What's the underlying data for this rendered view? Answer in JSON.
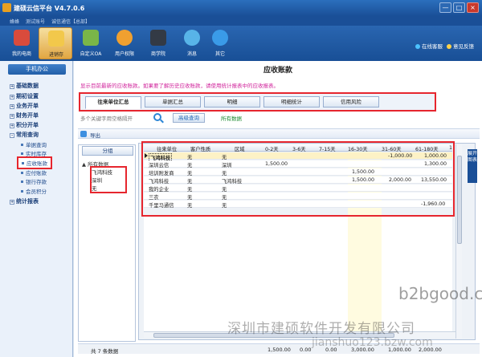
{
  "window": {
    "title": "建硕云信平台 V4.7.0.6",
    "min": "—",
    "max": "□",
    "close": "×"
  },
  "userbar": {
    "user": "蜂蜂",
    "account": "测试账号",
    "company": "诚信通信【总部】"
  },
  "topright": {
    "service": "在线客服",
    "feedback": "意见反馈"
  },
  "toolbar": [
    {
      "label": "我的电商",
      "icon": "home-icon",
      "color": "#d94b3c"
    },
    {
      "label": "进销存",
      "icon": "notepad-icon",
      "color": "#f2c84b"
    },
    {
      "label": "自定义OA",
      "icon": "pencil-ruler-icon",
      "color": "#7ab648"
    },
    {
      "label": "用户权限",
      "icon": "users-icon",
      "color": "#f0a030"
    },
    {
      "label": "商学院",
      "icon": "graduation-cap-icon",
      "color": "#333a45"
    },
    {
      "label": "消息",
      "icon": "chat-bubble-icon",
      "color": "#58b4e8"
    },
    {
      "label": "其它",
      "icon": "download-arrow-icon",
      "color": "#3a9be8"
    }
  ],
  "sidebar": {
    "head": "手机办公",
    "groups": [
      "基础数据",
      "期初设置",
      "业务开单",
      "财务开单",
      "积分开单",
      "常用查询"
    ],
    "subitems": [
      "单据查询",
      "实时库存",
      "应收账款",
      "应付账款",
      "银行存款",
      "会员积分"
    ],
    "selected": "应收账款",
    "last_group": "统计报表"
  },
  "main": {
    "title": "应收账款",
    "hint": "显示目前最新的应收账款。如果要了解历史应收账款，请使用统计报表中的应收报表。",
    "tabs": [
      "往来单位汇总",
      "单据汇总",
      "明细",
      "明细统计",
      "信用风险"
    ],
    "search_placeholder": "多个关键字用空格隔开",
    "adv_search": "高级查询",
    "all_data": "所有数据",
    "export": "导出",
    "group_btn": "分组",
    "tree_root": "所有数据",
    "tree_items": [
      "飞鸿科技",
      "深圳",
      "无"
    ],
    "side_strip": "展开图表"
  },
  "grid": {
    "headers": [
      "往来单位",
      "客户性质",
      "区域",
      "0-2天",
      "3-6天",
      "7-15天",
      "16-30天",
      "31-60天",
      "61-180天",
      "1"
    ],
    "rows": [
      [
        "飞鸿科技",
        "无",
        "无",
        "",
        "",
        "",
        "",
        "-1,000.00",
        "1,000.00"
      ],
      [
        "深圳云信",
        "无",
        "深圳",
        "1,500.00",
        "",
        "",
        "",
        "",
        "1,300.00"
      ],
      [
        "培训附发商",
        "无",
        "无",
        "",
        "",
        "",
        "1,500.00",
        "",
        ""
      ],
      [
        "飞鸿科技",
        "无",
        "飞鸿科技",
        "",
        "",
        "",
        "1,500.00",
        "2,000.00",
        "13,550.00"
      ],
      [
        "我的企业",
        "无",
        "无",
        "",
        "",
        "",
        "",
        "",
        ""
      ],
      [
        "三农",
        "无",
        "无",
        "",
        "",
        "",
        "",
        "",
        ""
      ],
      [
        "千里马通信",
        "无",
        "无",
        "",
        "",
        "",
        "",
        "",
        "-1,960.00"
      ]
    ],
    "footer": {
      "count": "共 7 条数据",
      "v1": "1,500.00",
      "v2": "0.00",
      "v3": "0.00",
      "v4": "3,000.00",
      "v5": "1,000.00",
      "v6": "2,000.00"
    }
  },
  "watermark": {
    "line1": "深圳市建硕软件开发有限公司",
    "line2": "jianshuo123.bzw.com",
    "line3": "b2bgood.com"
  }
}
